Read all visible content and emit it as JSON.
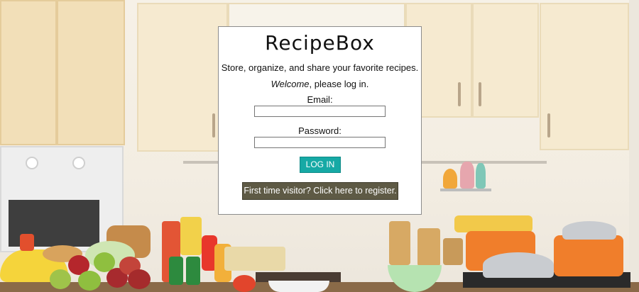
{
  "app": {
    "title": "RecipeBox",
    "tagline": "Store, organize, and share your favorite recipes.",
    "welcome_emph": "Welcome",
    "welcome_rest": ", please log in."
  },
  "form": {
    "email_label": "Email:",
    "email_value": "",
    "password_label": "Password:",
    "password_value": "",
    "login_label": "LOG IN",
    "register_label": "First time visitor? Click here to register."
  },
  "colors": {
    "login_button": "#16a9a5",
    "register_button": "#5e5a45"
  }
}
